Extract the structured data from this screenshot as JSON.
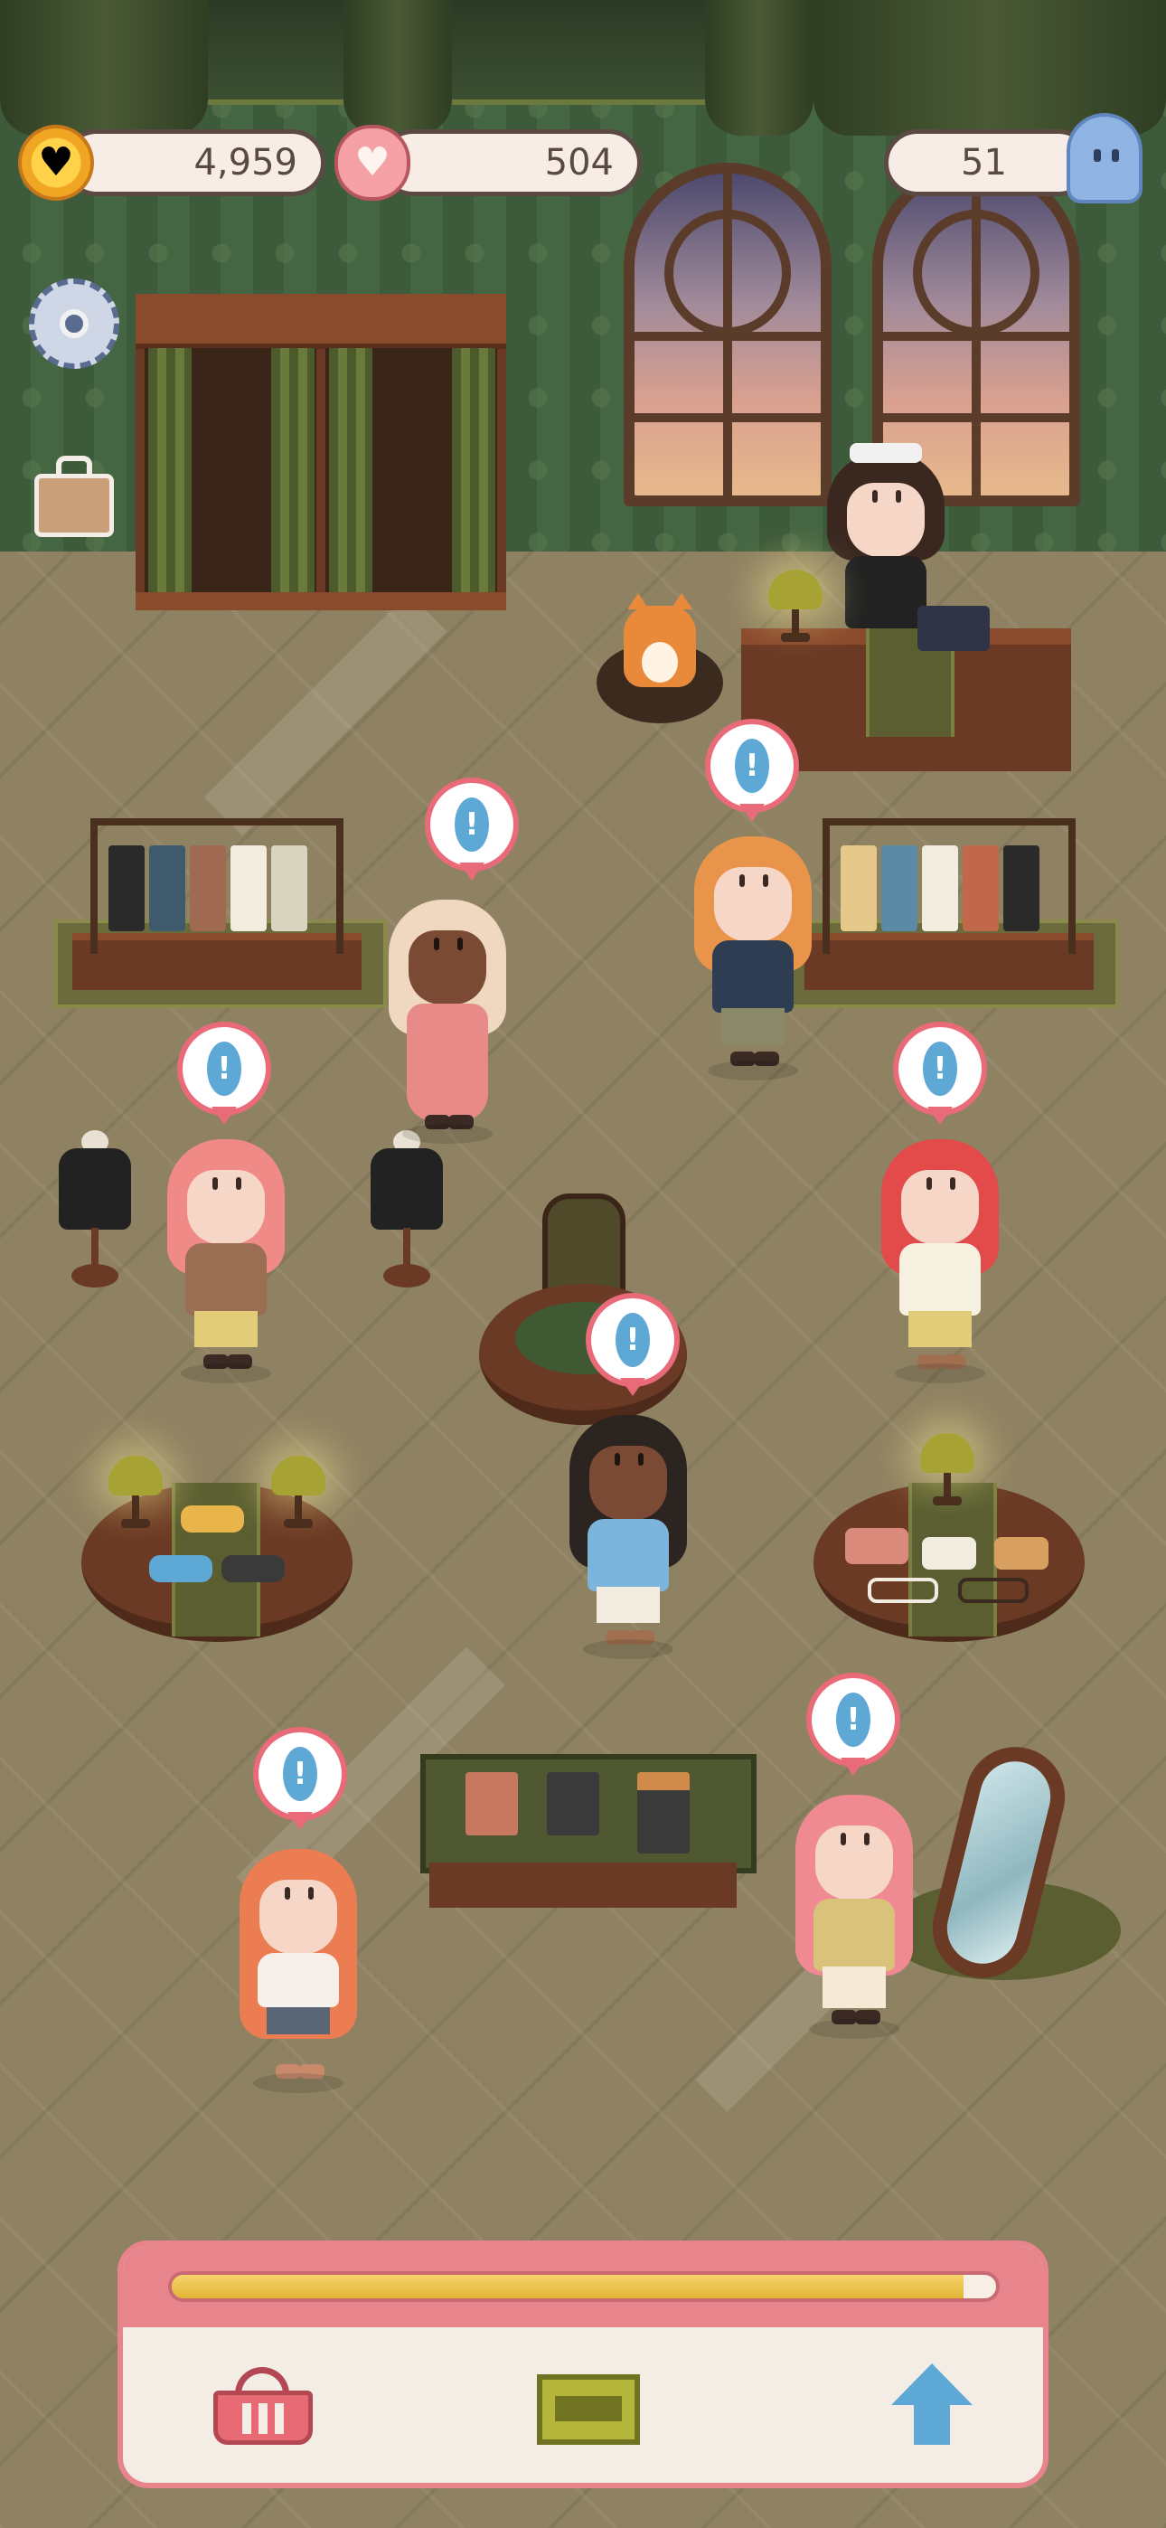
{
  "hud": {
    "coins": "4,959",
    "hearts": "504",
    "visitors": "51"
  },
  "progress": {
    "fraction": 0.96
  },
  "icons": {
    "coin": "coin-icon",
    "heart": "heart-icon",
    "visitor": "ghost-icon",
    "settings": "gear-icon",
    "inventory": "briefcase-icon",
    "basket": "basket-icon",
    "display": "display-case-icon",
    "upgrade": "arrow-up-icon",
    "request": "exclamation-icon"
  },
  "request_mark": "!",
  "colors": {
    "accent": "#e8848b",
    "bubble_border": "#e96a78",
    "request_blue": "#5ea8d6",
    "progress_fill": "#e2b434",
    "hud_text": "#5b4a44"
  }
}
